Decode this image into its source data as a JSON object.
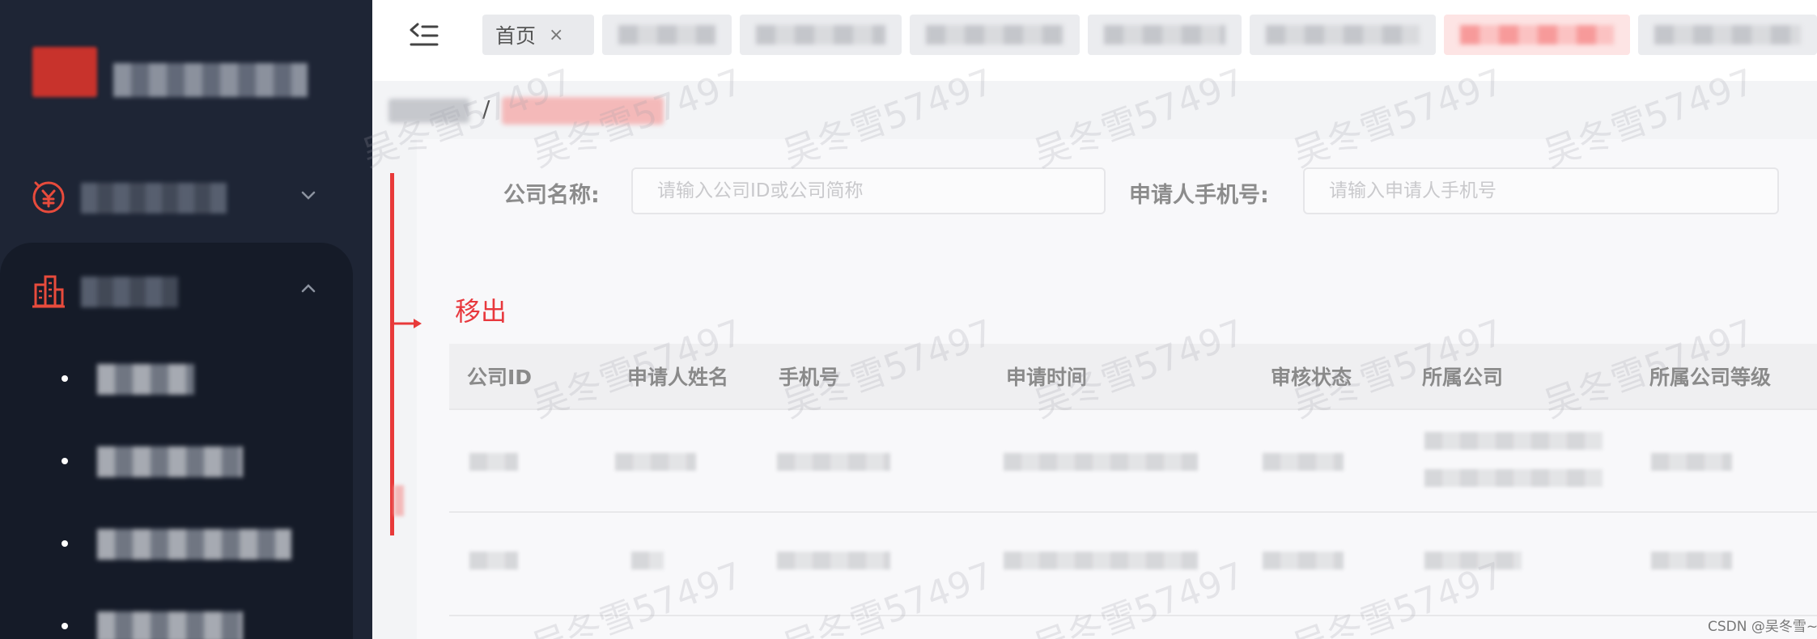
{
  "header": {
    "tabs": [
      {
        "label": "首页",
        "close": "×"
      }
    ]
  },
  "breadcrumb": {
    "separator": "/"
  },
  "filters": {
    "company_name": {
      "label": "公司名称:",
      "placeholder": "请输入公司ID或公司简称"
    },
    "applicant_phone": {
      "label": "申请人手机号:",
      "placeholder": "请输入申请人手机号"
    }
  },
  "annotation": {
    "text": "移出",
    "color": "#e8383d"
  },
  "table": {
    "columns": [
      "公司ID",
      "申请人姓名",
      "手机号",
      "申请时间",
      "审核状态",
      "所属公司",
      "所属公司等级"
    ]
  },
  "watermark": {
    "text": "吴冬雪57497"
  },
  "credit": {
    "text": "CSDN @吴冬雪~"
  },
  "colors": {
    "sidebar_bg": "#1e2535",
    "accent": "#e8383d",
    "icon_red": "#e84b3c"
  },
  "icons": {
    "menu_1": "yuan-coin-icon",
    "menu_2": "buildings-icon",
    "toggle": "menu-fold-icon"
  }
}
